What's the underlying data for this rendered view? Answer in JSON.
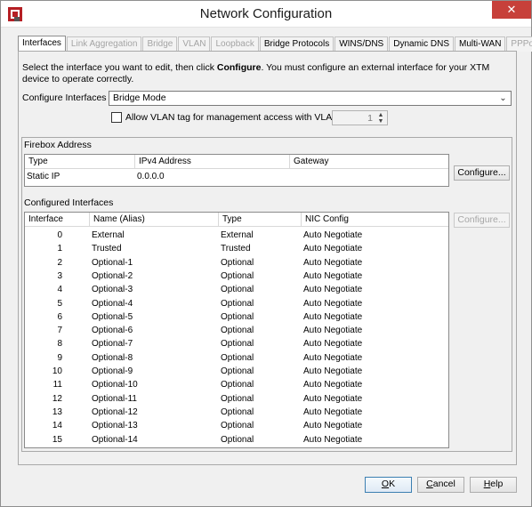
{
  "window": {
    "title": "Network Configuration",
    "close_glyph": "✕",
    "app_icon": "watchguard-icon"
  },
  "tabs": [
    {
      "label": "Interfaces",
      "state": "active"
    },
    {
      "label": "Link Aggregation",
      "state": "disabled"
    },
    {
      "label": "Bridge",
      "state": "disabled"
    },
    {
      "label": "VLAN",
      "state": "disabled"
    },
    {
      "label": "Loopback",
      "state": "disabled"
    },
    {
      "label": "Bridge Protocols",
      "state": "enabled"
    },
    {
      "label": "WINS/DNS",
      "state": "enabled"
    },
    {
      "label": "Dynamic DNS",
      "state": "enabled"
    },
    {
      "label": "Multi-WAN",
      "state": "enabled"
    },
    {
      "label": "PPPoE",
      "state": "disabled"
    }
  ],
  "instructions": {
    "part1": "Select the interface you want to edit, then click ",
    "bold": "Configure",
    "part2": ". You must configure an external interface for your XTM device to operate correctly."
  },
  "configure_in": {
    "label": "Configure Interfaces in",
    "value": "Bridge Mode"
  },
  "vlan_tag": {
    "label": "Allow VLAN tag for management access with VLAN ID",
    "checked": false,
    "vlan_id": "1"
  },
  "firebox": {
    "title": "Firebox Address",
    "columns": [
      "Type",
      "IPv4 Address",
      "Gateway"
    ],
    "rows": [
      [
        "Static IP",
        "0.0.0.0",
        ""
      ]
    ],
    "configure_label": "Configure..."
  },
  "configured": {
    "title": "Configured Interfaces",
    "columns": [
      "Interface",
      "Name (Alias)",
      "Type",
      "NIC Config"
    ],
    "rows": [
      [
        "0",
        "External",
        "External",
        "Auto Negotiate"
      ],
      [
        "1",
        "Trusted",
        "Trusted",
        "Auto Negotiate"
      ],
      [
        "2",
        "Optional-1",
        "Optional",
        "Auto Negotiate"
      ],
      [
        "3",
        "Optional-2",
        "Optional",
        "Auto Negotiate"
      ],
      [
        "4",
        "Optional-3",
        "Optional",
        "Auto Negotiate"
      ],
      [
        "5",
        "Optional-4",
        "Optional",
        "Auto Negotiate"
      ],
      [
        "6",
        "Optional-5",
        "Optional",
        "Auto Negotiate"
      ],
      [
        "7",
        "Optional-6",
        "Optional",
        "Auto Negotiate"
      ],
      [
        "8",
        "Optional-7",
        "Optional",
        "Auto Negotiate"
      ],
      [
        "9",
        "Optional-8",
        "Optional",
        "Auto Negotiate"
      ],
      [
        "10",
        "Optional-9",
        "Optional",
        "Auto Negotiate"
      ],
      [
        "11",
        "Optional-10",
        "Optional",
        "Auto Negotiate"
      ],
      [
        "12",
        "Optional-11",
        "Optional",
        "Auto Negotiate"
      ],
      [
        "13",
        "Optional-12",
        "Optional",
        "Auto Negotiate"
      ],
      [
        "14",
        "Optional-13",
        "Optional",
        "Auto Negotiate"
      ],
      [
        "15",
        "Optional-14",
        "Optional",
        "Auto Negotiate"
      ]
    ],
    "configure_label": "Configure..."
  },
  "footer": {
    "ok": {
      "label": "OK",
      "mnemonic": "O",
      "rest": "K"
    },
    "cancel": {
      "label": "Cancel",
      "mnemonic": "C",
      "rest": "ancel"
    },
    "help": {
      "label": "Help",
      "mnemonic": "H",
      "rest": "elp"
    }
  }
}
